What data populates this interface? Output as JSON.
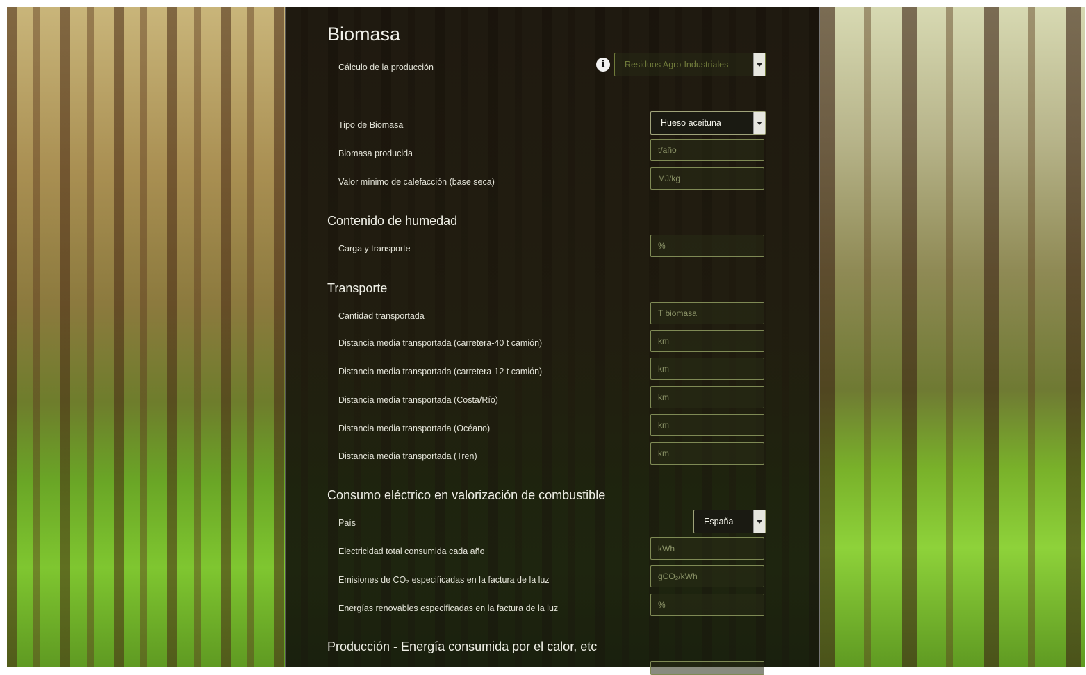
{
  "title": "Biomasa",
  "calculo": {
    "label": "Cálculo de la producción",
    "select_value": "Residuos Agro-Industriales"
  },
  "biomasa": {
    "tipo_label": "Tipo de Biomasa",
    "tipo_value": "Hueso aceituna",
    "producida_label": "Biomasa producida",
    "producida_placeholder": "t/año",
    "valor_label": "Valor mínimo de calefacción (base seca)",
    "valor_placeholder": "MJ/kg"
  },
  "humedad": {
    "heading": "Contenido de humedad",
    "carga_label": "Carga y transporte",
    "carga_placeholder": "%"
  },
  "transporte": {
    "heading": "Transporte",
    "rows": [
      {
        "label": "Cantidad transportada",
        "placeholder": "T biomasa"
      },
      {
        "label": "Distancia media transportada (carretera-40 t camión)",
        "placeholder": "km"
      },
      {
        "label": "Distancia media transportada (carretera-12 t camión)",
        "placeholder": "km"
      },
      {
        "label": "Distancia media transportada (Costa/Río)",
        "placeholder": "km"
      },
      {
        "label": "Distancia media transportada (Océano)",
        "placeholder": "km"
      },
      {
        "label": "Distancia media transportada (Tren)",
        "placeholder": "km"
      }
    ]
  },
  "consumo": {
    "heading": "Consumo eléctrico en valorización de combustible",
    "pais_label": "País",
    "pais_value": "España",
    "rows": [
      {
        "label": "Electricidad total consumida cada año",
        "placeholder": "kWh"
      },
      {
        "label": "Emisiones de CO₂ especificadas en la factura de la luz",
        "placeholder": "gCO₂/kWh"
      },
      {
        "label": "Energías renovables especificadas en la factura de la luz",
        "placeholder": "%"
      }
    ]
  },
  "produccion": {
    "heading": "Producción - Energía consumida por el calor, etc"
  }
}
